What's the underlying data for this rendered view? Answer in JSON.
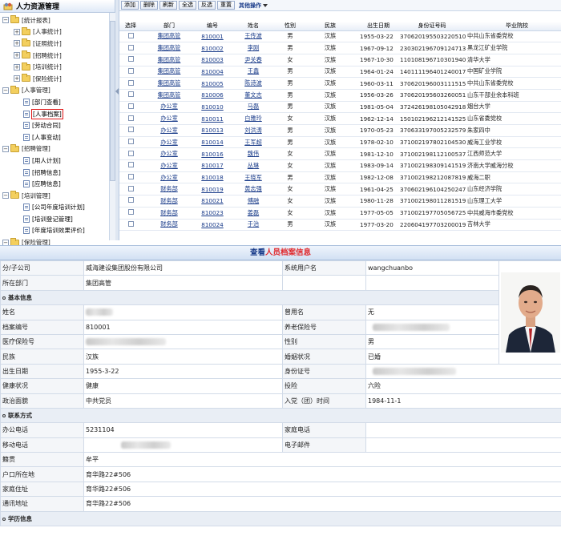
{
  "sidebar": {
    "title": "人力资源管理",
    "tree": [
      {
        "label": "[统计报表]",
        "level": 1,
        "type": "folder",
        "toggle": "−"
      },
      {
        "label": "[人事统计]",
        "level": 2,
        "type": "folder",
        "toggle": "+"
      },
      {
        "label": "[证照统计]",
        "level": 2,
        "type": "folder",
        "toggle": "+"
      },
      {
        "label": "[招聘统计]",
        "level": 2,
        "type": "folder",
        "toggle": "+"
      },
      {
        "label": "[培训统计]",
        "level": 2,
        "type": "folder",
        "toggle": "+"
      },
      {
        "label": "[保险统计]",
        "level": 2,
        "type": "folder",
        "toggle": "+"
      },
      {
        "label": "[人事管理]",
        "level": 1,
        "type": "folder",
        "toggle": "−"
      },
      {
        "label": "[部门查看]",
        "level": 3,
        "type": "doc"
      },
      {
        "label": "[人事档案]",
        "level": 3,
        "type": "doc",
        "selected": true
      },
      {
        "label": "[劳动合同]",
        "level": 3,
        "type": "doc"
      },
      {
        "label": "[人事变动]",
        "level": 3,
        "type": "doc"
      },
      {
        "label": "[招聘管理]",
        "level": 1,
        "type": "folder",
        "toggle": "−"
      },
      {
        "label": "[用人计划]",
        "level": 3,
        "type": "doc"
      },
      {
        "label": "[招聘信息]",
        "level": 3,
        "type": "doc"
      },
      {
        "label": "[应聘信息]",
        "level": 3,
        "type": "doc"
      },
      {
        "label": "[培训管理]",
        "level": 1,
        "type": "folder",
        "toggle": "−"
      },
      {
        "label": "[公司年度培训计划]",
        "level": 3,
        "type": "doc"
      },
      {
        "label": "[培训登记管理]",
        "level": 3,
        "type": "doc"
      },
      {
        "label": "[年度培训效果评价]",
        "level": 3,
        "type": "doc"
      },
      {
        "label": "[保险管理]",
        "level": 1,
        "type": "folder",
        "toggle": "−"
      }
    ]
  },
  "toolbar": {
    "buttons": [
      "添加",
      "删除",
      "刷新",
      "全选",
      "反选",
      "重置"
    ],
    "more": "其他操作"
  },
  "grid": {
    "columns": [
      "选择",
      "部门",
      "编号",
      "姓名",
      "性别",
      "民族",
      "出生日期",
      "身份证号码",
      "毕业院校"
    ],
    "rows": [
      [
        "集团高管",
        "810001",
        "王传波",
        "男",
        "汉族",
        "1955-03-22",
        "370620195503220510",
        "中共山东省委党校"
      ],
      [
        "集团高管",
        "810002",
        "李刚",
        "男",
        "汉族",
        "1967-09-12",
        "230302196709124713",
        "黑龙江矿业学院"
      ],
      [
        "集团高管",
        "810003",
        "尹关春",
        "女",
        "汉族",
        "1967-10-30",
        "110108196710301940",
        "清华大学"
      ],
      [
        "集团高管",
        "810004",
        "王鑫",
        "男",
        "汉族",
        "1964-01-24",
        "140111196401240017",
        "中国矿业学院"
      ],
      [
        "集团高管",
        "810005",
        "陈诗波",
        "男",
        "汉族",
        "1960-03-11",
        "370620196003111515",
        "中共山东省委党校"
      ],
      [
        "集团高管",
        "810006",
        "董文志",
        "男",
        "汉族",
        "1956-03-26",
        "370620195603260051",
        "山东干部业余本科班"
      ],
      [
        "办公室",
        "810010",
        "马磊",
        "男",
        "汉族",
        "1981-05-04",
        "372426198105042918",
        "烟台大学"
      ],
      [
        "办公室",
        "810011",
        "白雅玲",
        "女",
        "汉族",
        "1962-12-14",
        "150102196212141525",
        "山东省委党校"
      ],
      [
        "办公室",
        "810013",
        "刘洪涛",
        "男",
        "汉族",
        "1970-05-23",
        "370633197005232579",
        "朱家四中"
      ],
      [
        "办公室",
        "810014",
        "王军超",
        "男",
        "汉族",
        "1978-02-10",
        "371002197802104530",
        "威海工业学校"
      ],
      [
        "办公室",
        "810016",
        "魏伟",
        "女",
        "汉族",
        "1981-12-10",
        "371002198112100537",
        "江西师范大学"
      ],
      [
        "办公室",
        "810017",
        "丛琳",
        "女",
        "汉族",
        "1983-09-14",
        "371002198309141519",
        "济南大学威海分校"
      ],
      [
        "办公室",
        "810018",
        "王晓军",
        "男",
        "汉族",
        "1982-12-08",
        "371002198212087819",
        "威海二职"
      ],
      [
        "财务部",
        "810019",
        "黄志强",
        "女",
        "汉族",
        "1961-04-25",
        "370602196104250247",
        "山东经济学院"
      ],
      [
        "财务部",
        "810021",
        "傅融",
        "女",
        "汉族",
        "1980-11-28",
        "371002198011281519",
        "山东理工大学"
      ],
      [
        "财务部",
        "810023",
        "姜磊",
        "女",
        "汉族",
        "1977-05-05",
        "371002197705056725",
        "中共威海市委党校"
      ],
      [
        "财务部",
        "810024",
        "于治",
        "男",
        "汉族",
        "1977-03-20",
        "220604197703200019",
        "吉林大学"
      ]
    ]
  },
  "detail": {
    "title_prefix": "查看",
    "title_highlight": "人员档案信息",
    "company_label": "分/子公司",
    "company": "威海建设集团股份有限公司",
    "sysuser_label": "系统用户名",
    "sysuser": "wangchuanbo",
    "dept_label": "所在部门",
    "dept": "集团高管",
    "sec_basic": "基本信息",
    "name_label": "姓名",
    "usedname_label": "曾用名",
    "usedname": "无",
    "archive_label": "档案编号",
    "archive": "810001",
    "pension_label": "养老保险号",
    "medical_label": "医疗保险号",
    "gender_label": "性别",
    "gender": "男",
    "nation_label": "民族",
    "nation": "汉族",
    "marital_label": "婚姻状况",
    "marital": "已婚",
    "birth_label": "出生日期",
    "birth": "1955-3-22",
    "idno_label": "身份证号",
    "health_label": "健康状况",
    "health": "健康",
    "insure_label": "投险",
    "insure": "六险",
    "political_label": "政治面貌",
    "political": "中共党员",
    "join_label": "入党（团）时间",
    "join": "1984-11-1",
    "sec_contact": "联系方式",
    "office_label": "办公电话",
    "office": "5231104",
    "home_label": "家庭电话",
    "mobile_label": "移动电话",
    "email_label": "电子邮件",
    "native_label": "籍贯",
    "native": "牟平",
    "hukou_label": "户口所在地",
    "hukou": "育华路22#506",
    "address_label": "家庭住址",
    "address": "育华路22#506",
    "mail_label": "通讯地址",
    "mail": "育华路22#506",
    "sec_edu": "学历信息"
  },
  "colors": {
    "accent": "#1a3c8a",
    "highlight": "#e0282c",
    "selected_border": "#e01818"
  }
}
